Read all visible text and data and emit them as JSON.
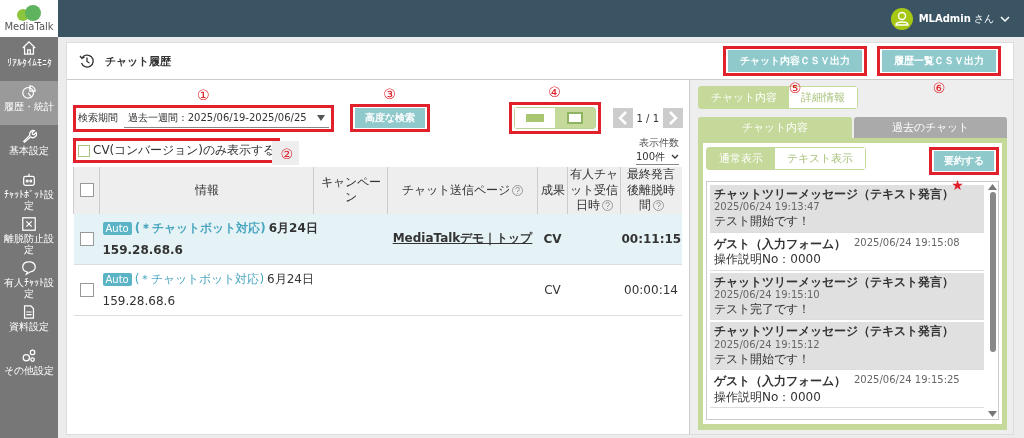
{
  "logo": {
    "name": "MediaTalk"
  },
  "sidebar": {
    "items": [
      {
        "label": "ﾘｱﾙﾀｲﾑﾓﾆﾀ",
        "selected": false
      },
      {
        "label": "履歴・統計",
        "selected": true
      },
      {
        "label": "基本設定",
        "selected": false
      },
      {
        "label": "ﾁｬｯﾄﾎﾞｯﾄ設定",
        "selected": false
      },
      {
        "label": "離脱防止設定",
        "selected": false
      },
      {
        "label": "有人ﾁｬｯﾄ設定",
        "selected": false
      },
      {
        "label": "資料設定",
        "selected": false
      },
      {
        "label": "その他設定",
        "selected": false
      }
    ]
  },
  "user": {
    "name": "**MLAdmin** さん"
  },
  "page": {
    "title": "チャット履歴"
  },
  "export_buttons": [
    {
      "label": "チャット内容ＣＳＶ出力",
      "callout": "⑤"
    },
    {
      "label": "履歴一覧ＣＳＶ出力",
      "callout": "⑥"
    }
  ],
  "filter": {
    "label": "検索期間",
    "value": "過去一週間 : 2025/06/19-2025/06/25",
    "callout": "①"
  },
  "advanced_search": {
    "label": "高度な検索",
    "callout": "③"
  },
  "cv_only": {
    "label": "CV(コンバージョン)のみ表示する",
    "checked": false,
    "callout": "②"
  },
  "view_toggle": {
    "callout": "④",
    "options": [
      {
        "selected": false
      },
      {
        "selected": true
      }
    ]
  },
  "pagination": {
    "text": "1 / 1"
  },
  "page_size": {
    "label": "表示件数",
    "value": "100件"
  },
  "table": {
    "select_all_checked": false,
    "columns": [
      {
        "label": "情報",
        "help": false
      },
      {
        "label": "キャンペーン",
        "help": false
      },
      {
        "label": "チャット送信ページ",
        "help": true
      },
      {
        "label": "成果",
        "help": false
      },
      {
        "label": "有人チャット受信日時",
        "help": true
      },
      {
        "label": "最終発言後離脱時間",
        "help": true
      }
    ],
    "rows": [
      {
        "selected": true,
        "checked": false,
        "badge": "Auto",
        "title": "(＊チャットボット対応)",
        "date": "6月24日",
        "ip": "159.28.68.6",
        "page": "MediaTalkデモ｜トップ",
        "result": "CV",
        "time": "00:11:15"
      },
      {
        "selected": false,
        "checked": false,
        "badge": "Auto",
        "title": "(＊チャットボット対応)",
        "date": "6月24日",
        "ip": "159.28.68.6",
        "page": "",
        "result": "CV",
        "time": "00:00:14"
      }
    ]
  },
  "detail": {
    "toggle": [
      {
        "label": "チャット内容",
        "selected": true
      },
      {
        "label": "詳細情報",
        "selected": false
      }
    ],
    "tabs": [
      {
        "label": "チャット内容",
        "selected": true
      },
      {
        "label": "過去のチャット",
        "selected": false
      }
    ],
    "mode": [
      {
        "label": "通常表示",
        "selected": true
      },
      {
        "label": "テキスト表示",
        "selected": false
      }
    ],
    "summarize": {
      "label": "要約する",
      "callout": "★"
    },
    "messages": [
      {
        "kind": "bot",
        "sender": "チャットツリーメッセージ（テキスト発言）",
        "time": "2025/06/24 19:13:47",
        "text": "テスト開始です！"
      },
      {
        "kind": "guest",
        "sender": "ゲスト（入力フォーム）",
        "time": "2025/06/24 19:15:08",
        "text": "操作説明No：0000"
      },
      {
        "kind": "bot",
        "sender": "チャットツリーメッセージ（テキスト発言）",
        "time": "2025/06/24 19:15:10",
        "text": "テスト完了です！"
      },
      {
        "kind": "bot",
        "sender": "チャットツリーメッセージ（テキスト発言）",
        "time": "2025/06/24 19:15:12",
        "text": "テスト開始です！"
      },
      {
        "kind": "guest",
        "sender": "ゲスト（入力フォーム）",
        "time": "2025/06/24 19:15:25",
        "text": "操作説明No：0000"
      }
    ]
  }
}
